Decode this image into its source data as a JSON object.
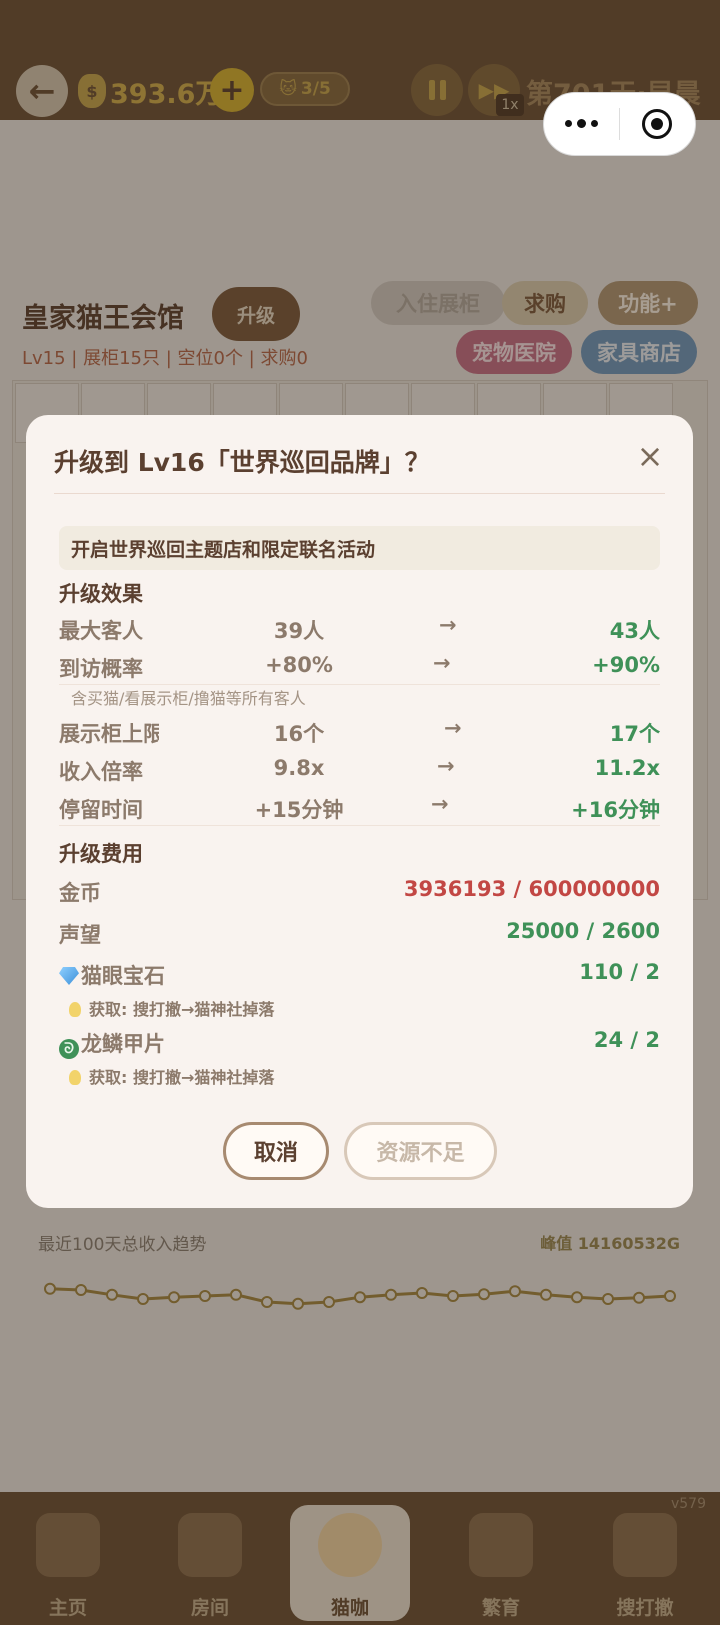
{
  "topbar": {
    "money": "393.6万",
    "money_icon": "$",
    "cat_count": "3/5",
    "speed": "1x",
    "day": "第701天·早晨"
  },
  "shop": {
    "name": "皇家猫王会馆",
    "upgrade_label": "升级",
    "stats": "Lv15 | 展柜15只 | 空位0个 | 求购0",
    "buttons": {
      "checkin": "入住展柜",
      "buy": "求购",
      "func": "功能+",
      "hospital": "宠物医院",
      "furniture": "家具商店"
    }
  },
  "dialog": {
    "title": "升级到 Lv16「世界巡回品牌」？",
    "close": "×",
    "description": "开启世界巡回主题店和限定联名活动",
    "effects_heading": "升级效果",
    "effects": [
      {
        "name": "最大客人",
        "from": "39人",
        "arrow": "→",
        "to": "43人",
        "sub": ""
      },
      {
        "name": "到访概率",
        "from": "+80%",
        "arrow": "→",
        "to": "+90%",
        "sub": "含买猫/看展示柜/撸猫等所有客人"
      },
      {
        "name": "展示柜上限",
        "from": "16个",
        "arrow": "→",
        "to": "17个",
        "sub": ""
      },
      {
        "name": "收入倍率",
        "from": "9.8x",
        "arrow": "→",
        "to": "11.2x",
        "sub": ""
      },
      {
        "name": "停留时间",
        "from": "+15分钟",
        "arrow": "→",
        "to": "+16分钟",
        "sub": ""
      }
    ],
    "cost_heading": "升级费用",
    "costs": [
      {
        "name": "金币",
        "value": "3936193 / 600000000",
        "status": "insufficient"
      },
      {
        "name": "声望",
        "value": "25000 / 2600",
        "status": "ok"
      },
      {
        "name": "猫眼宝石",
        "value": "110 / 2",
        "status": "ok",
        "hint": "获取: 搜打撤→猫神社掉落",
        "icon": "gem"
      },
      {
        "name": "龙鳞甲片",
        "value": "24 / 2",
        "status": "ok",
        "hint": "获取: 搜打撤→猫神社掉落",
        "icon": "dragon"
      }
    ],
    "cancel_label": "取消",
    "insufficient_label": "资源不足"
  },
  "chart": {
    "title": "最近100天总收入趋势",
    "peak": "峰值 14160532G"
  },
  "chart_data": {
    "type": "line",
    "title": "最近100天总收入趋势",
    "values": [
      0.72,
      0.7,
      0.62,
      0.55,
      0.58,
      0.6,
      0.62,
      0.5,
      0.47,
      0.5,
      0.58,
      0.62,
      0.65,
      0.6,
      0.63,
      0.68,
      0.62,
      0.58,
      0.55,
      0.57,
      0.6
    ]
  },
  "nav": {
    "version": "v579",
    "items": [
      "主页",
      "房间",
      "猫咖",
      "繁育",
      "搜打撤"
    ],
    "active": "猫咖"
  },
  "colors": {
    "accent_brown": "#6b5136",
    "green_ok": "#3f9158",
    "red_insufficient": "#c24744"
  }
}
